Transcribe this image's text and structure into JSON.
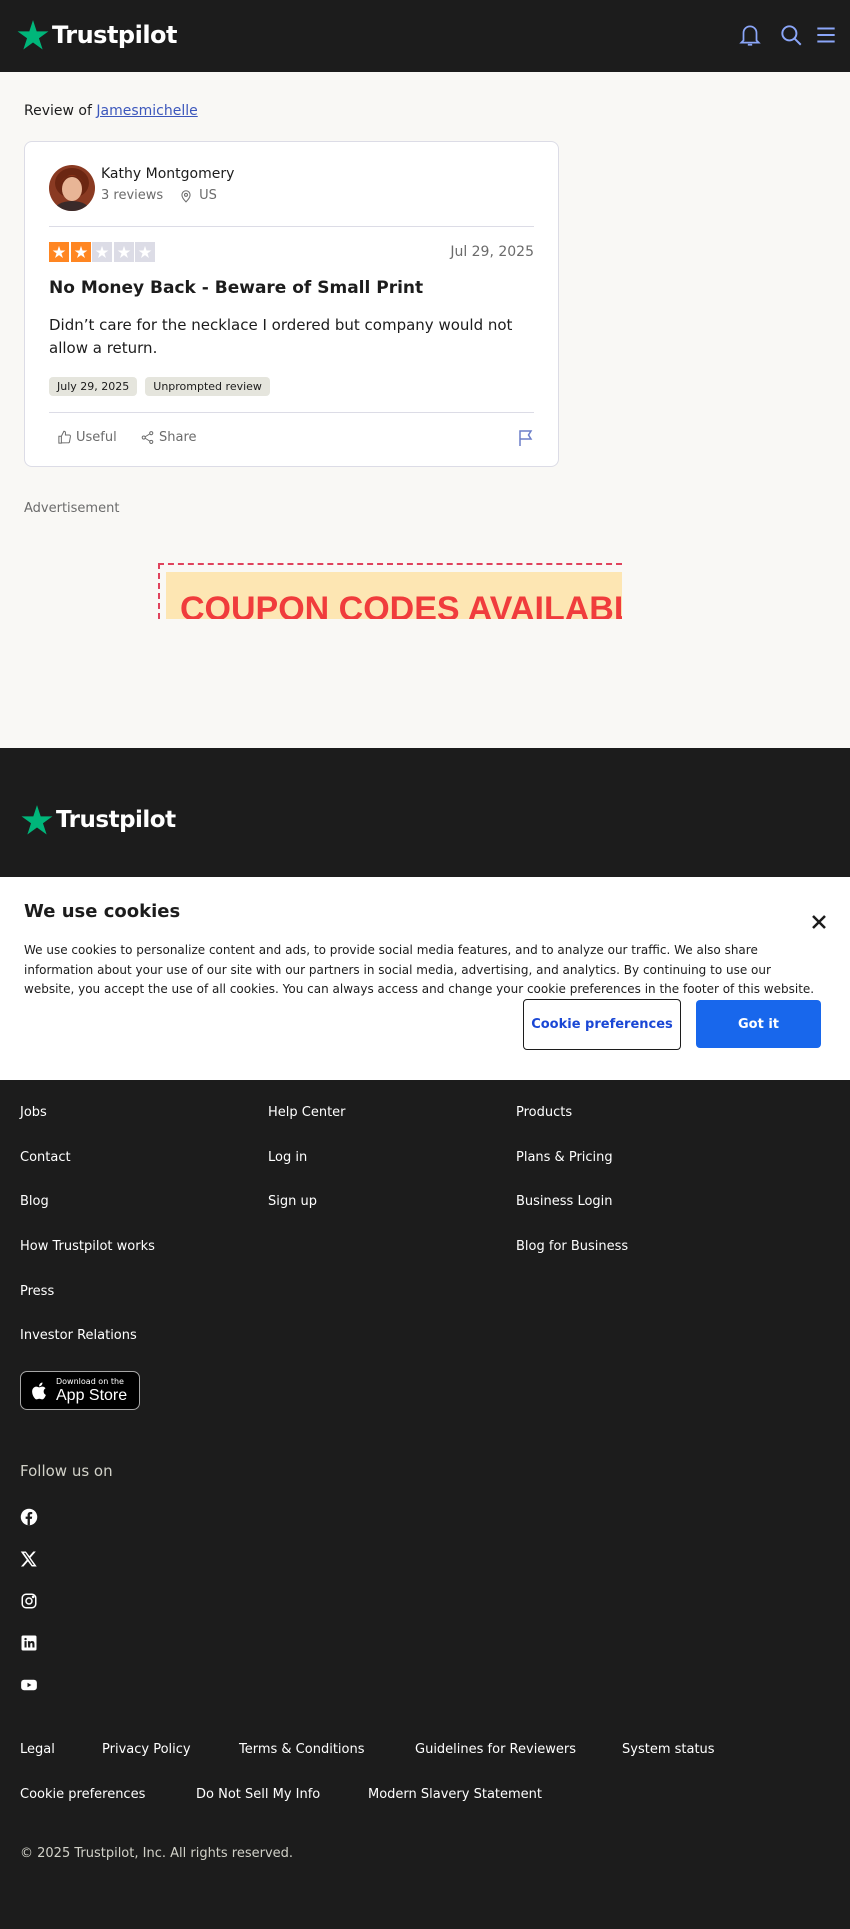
{
  "header": {
    "brand": "Trustpilot",
    "icons": [
      "bell-icon",
      "search-icon",
      "menu-icon"
    ],
    "colors": {
      "background": "#1c1c1c",
      "brand_green": "#00b67a",
      "icon_blue": "#8ba6f8"
    }
  },
  "review_of": {
    "prefix": "Review of",
    "company": "Jamesmichelle"
  },
  "review": {
    "reviewer_name": "Kathy Montgomery",
    "reviewer_reviews": "3 reviews",
    "reviewer_country": "US",
    "rating": 2,
    "rating_max": 5,
    "star_color": "#ff8622",
    "date": "Jul 29, 2025",
    "title": "No Money Back - Beware of Small Print",
    "body": "Didn’t care for the necklace I ordered but company would not allow a return.",
    "tags": [
      "July 29, 2025",
      "Unprompted review"
    ],
    "useful_label": "Useful",
    "share_label": "Share"
  },
  "ad": {
    "label": "Advertisement",
    "text": "COUPON CODES AVAILABLE"
  },
  "footer": {
    "brand": "Trustpilot",
    "col1": [
      "Jobs",
      "Contact",
      "Blog",
      "How Trustpilot works",
      "Press",
      "Investor Relations"
    ],
    "col2": [
      "Help Center",
      "Log in",
      "Sign up"
    ],
    "col3": [
      "Products",
      "Plans & Pricing",
      "Business Login",
      "Blog for Business"
    ],
    "app_store_small": "Download on the",
    "app_store_big": "App Store",
    "follow_label": "Follow us on",
    "socials": [
      "facebook-icon",
      "x-icon",
      "instagram-icon",
      "linkedin-icon",
      "youtube-icon"
    ],
    "legal_row1": [
      "Legal",
      "Privacy Policy",
      "Terms & Conditions",
      "Guidelines for Reviewers",
      "System status"
    ],
    "legal_row2": [
      "Cookie preferences",
      "Do Not Sell My Info",
      "Modern Slavery Statement"
    ],
    "copyright": "© 2025 Trustpilot, Inc. All rights reserved."
  },
  "cookie_banner": {
    "title": "We use cookies",
    "text": "We use cookies to personalize content and ads, to provide social media features, and to analyze our traffic. We also share information about your use of our site with our partners in social media, advertising, and analytics. By continuing to use our website, you accept the use of all cookies. You can always access and change your cookie preferences in the footer of this website.",
    "preferences_label": "Cookie preferences",
    "accept_label": "Got it"
  }
}
